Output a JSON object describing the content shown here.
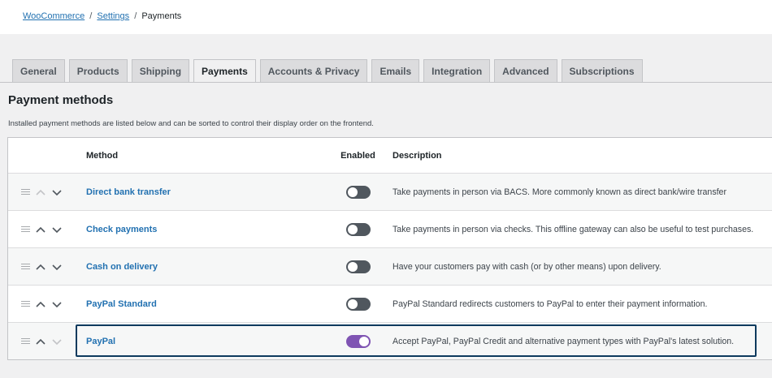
{
  "breadcrumb": {
    "root": "WooCommerce",
    "section": "Settings",
    "current": "Payments",
    "separator": "/"
  },
  "tabs": [
    {
      "label": "General"
    },
    {
      "label": "Products"
    },
    {
      "label": "Shipping"
    },
    {
      "label": "Payments",
      "active": true
    },
    {
      "label": "Accounts & Privacy"
    },
    {
      "label": "Emails"
    },
    {
      "label": "Integration"
    },
    {
      "label": "Advanced"
    },
    {
      "label": "Subscriptions"
    }
  ],
  "section": {
    "title": "Payment methods",
    "description": "Installed payment methods are listed below and can be sorted to control their display order on the frontend."
  },
  "table": {
    "headers": {
      "method": "Method",
      "enabled": "Enabled",
      "description": "Description"
    },
    "rows": [
      {
        "method": "Direct bank transfer",
        "enabled": false,
        "description": "Take payments in person via BACS. More commonly known as direct bank/wire transfer"
      },
      {
        "method": "Check payments",
        "enabled": false,
        "description": "Take payments in person via checks. This offline gateway can also be useful to test purchases."
      },
      {
        "method": "Cash on delivery",
        "enabled": false,
        "description": "Have your customers pay with cash (or by other means) upon delivery."
      },
      {
        "method": "PayPal Standard",
        "enabled": false,
        "description": "PayPal Standard redirects customers to PayPal to enter their payment information."
      },
      {
        "method": "PayPal",
        "enabled": true,
        "description": "Accept PayPal, PayPal Credit and alternative payment types with PayPal's latest solution."
      }
    ]
  },
  "colors": {
    "link": "#2271b1",
    "toggle_off": "#50575e",
    "toggle_on": "#7f54b3",
    "highlight": "#0e3a5e"
  },
  "icons": {
    "drag": "drag-handle-icon",
    "up": "chevron-up-icon",
    "down": "chevron-down-icon"
  }
}
